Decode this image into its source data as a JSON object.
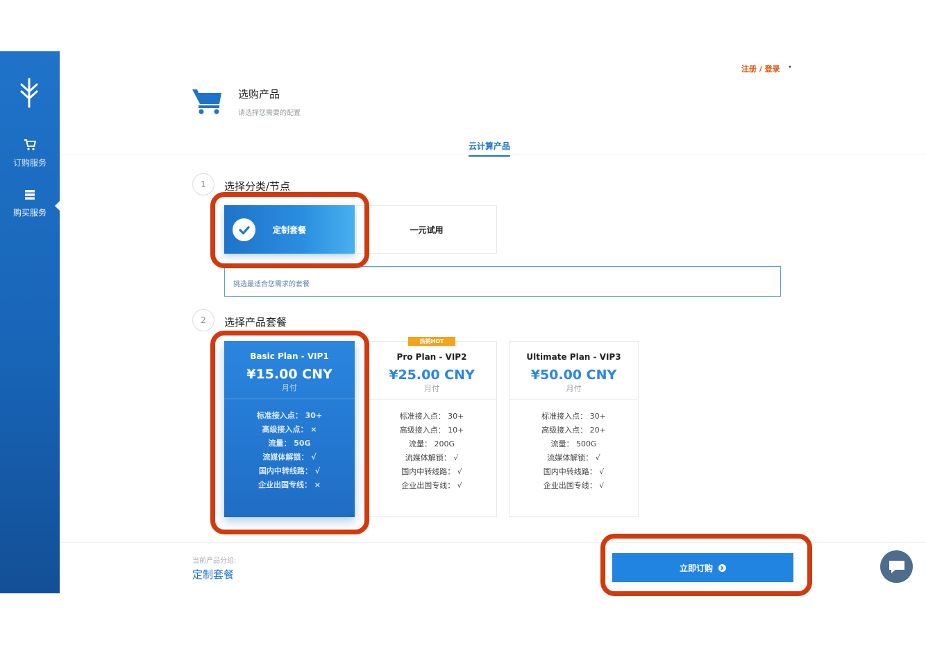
{
  "header": {
    "login_label": "注册 / 登录",
    "caret": "▾",
    "title": "选购产品",
    "subtitle": "请选择您需要的配置",
    "tab_label": "云计算产品"
  },
  "sidebar": {
    "items": [
      {
        "label": "订购服务",
        "icon": "cart-icon"
      },
      {
        "label": "购买服务",
        "icon": "server-list-icon",
        "active": true
      }
    ]
  },
  "step1": {
    "number": "1",
    "title": "选择分类/节点",
    "categories": [
      {
        "label": "定制套餐",
        "selected": true
      },
      {
        "label": "一元试用",
        "selected": false
      }
    ],
    "hint": "挑选最适合您需求的套餐"
  },
  "step2": {
    "number": "2",
    "title": "选择产品套餐",
    "hot_badge": "热销HOT",
    "plans": [
      {
        "name": "Basic Plan - VIP1",
        "price": "¥15.00 CNY",
        "period": "月付",
        "selected": true,
        "features": [
          "标准接入点： 30+",
          "高级接入点： ×",
          "流量： 50G",
          "流媒体解锁： √",
          "国内中转线路： √",
          "企业出国专线： ×"
        ]
      },
      {
        "name": "Pro Plan - VIP2",
        "price": "¥25.00 CNY",
        "period": "月付",
        "selected": false,
        "features": [
          "标准接入点： 30+",
          "高级接入点： 10+",
          "流量： 200G",
          "流媒体解锁： √",
          "国内中转线路： √",
          "企业出国专线： √"
        ]
      },
      {
        "name": "Ultimate Plan - VIP3",
        "price": "¥50.00 CNY",
        "period": "月付",
        "selected": false,
        "features": [
          "标准接入点： 30+",
          "高级接入点： 20+",
          "流量： 500G",
          "流媒体解锁： √",
          "国内中转线路： √",
          "企业出国专线： √"
        ]
      }
    ]
  },
  "footer": {
    "current_group_label": "当前产品分组:",
    "current_group_value": "定制套餐",
    "order_button": "立即订购"
  },
  "colors": {
    "primary": "#2184e0",
    "sidebar": "#1f73c9",
    "highlight": "#d23a0d",
    "hot": "#f6a21a"
  }
}
